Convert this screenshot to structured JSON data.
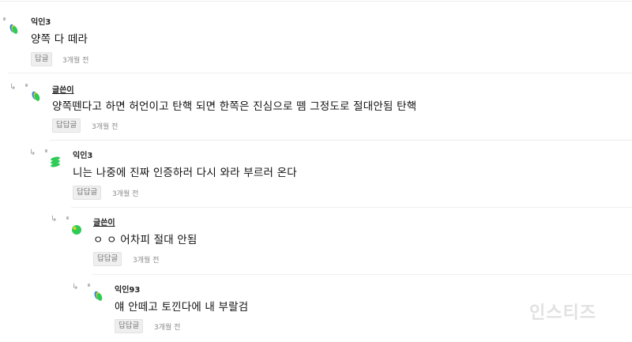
{
  "comments": [
    {
      "author": "익인3",
      "text": "양쪽 다 떼라",
      "reply_label": "답글",
      "time": "3개월 전"
    },
    {
      "author": "글쓴이",
      "text": "양쪽뗀다고 하면 허언이고 탄핵 되면 한쪽은 진심으로 뗌 그정도로 절대안됨 탄핵",
      "reply_label": "답답글",
      "time": "3개월 전"
    },
    {
      "author": "익인3",
      "text": "니는 나중에 진짜 인증하러 다시 와라 부르러 온다",
      "reply_label": "답답글",
      "time": "3개월 전"
    },
    {
      "author": "글쓴이",
      "text": "ㅇ ㅇ 어차피 절대 안됨",
      "reply_label": "답답글",
      "time": "3개월 전"
    },
    {
      "author": "익인93",
      "text": "얘 안떼고 토낀다에 내 부랄검",
      "reply_label": "답답글",
      "time": "3개월 전"
    }
  ],
  "icons": {
    "reply_arrow": "reply-arrow-icon",
    "avatar": "avatar-icon"
  },
  "colors": {
    "avatar_green": "#2ecc55",
    "avatar_yellow": "#f2d31b",
    "avatar_blue": "#2e86de",
    "button_bg": "#efefef",
    "watermark": "#d7d7d7"
  },
  "watermark": "인스티즈"
}
